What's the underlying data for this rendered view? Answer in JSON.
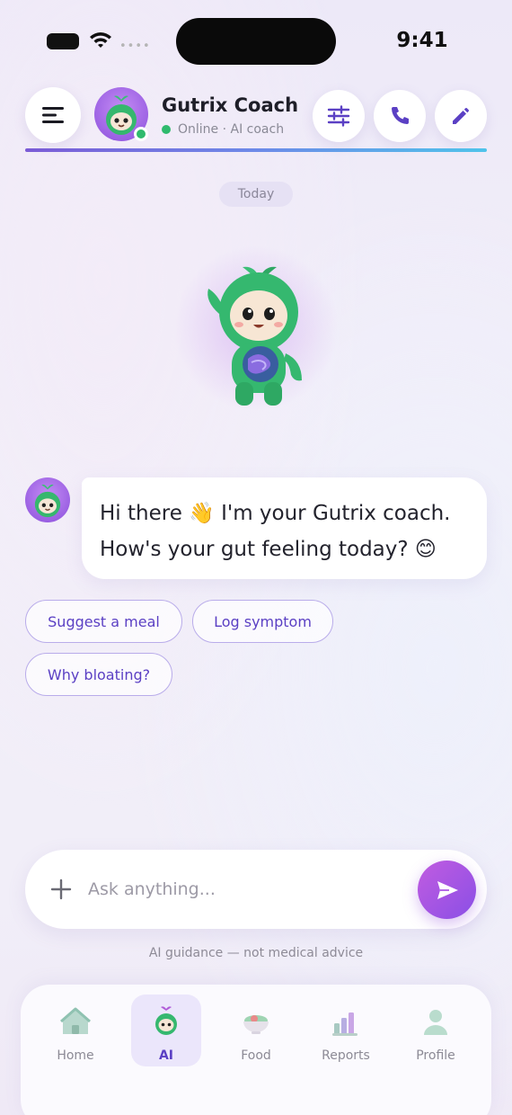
{
  "status_bar": {
    "time": "9:41"
  },
  "header": {
    "title": "Gutrix Coach",
    "status": "Online · AI coach"
  },
  "chat": {
    "date_label": "Today",
    "message_line1": "Hi there 👋 I'm your Gutrix coach.",
    "message_line2": "How's your gut feeling today? 😊",
    "quick_replies": [
      "Suggest a meal",
      "Log symptom",
      "Why bloating?"
    ]
  },
  "composer": {
    "placeholder": "Ask anything..."
  },
  "disclaimer": "AI guidance — not medical advice",
  "nav": {
    "items": [
      {
        "label": "Home",
        "icon": "home-icon"
      },
      {
        "label": "AI",
        "icon": "ai-coach-icon",
        "active": true
      },
      {
        "label": "Food",
        "icon": "food-bowl-icon"
      },
      {
        "label": "Reports",
        "icon": "bar-chart-icon"
      },
      {
        "label": "Profile",
        "icon": "profile-icon"
      }
    ]
  },
  "colors": {
    "accent": "#5b40c4",
    "online": "#2fba6d",
    "send_gradient_start": "#c15ce0",
    "send_gradient_end": "#8a4fe6"
  }
}
